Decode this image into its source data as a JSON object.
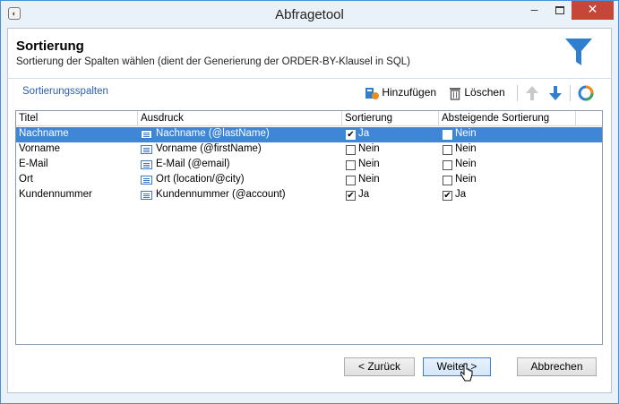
{
  "window": {
    "title": "Abfragetool"
  },
  "header": {
    "title": "Sortierung",
    "subtitle": "Sortierung der Spalten wählen (dient der Generierung der ORDER-BY-Klausel in SQL)"
  },
  "section": {
    "label": "Sortierungsspalten"
  },
  "toolbar": {
    "add_label": "Hinzufügen",
    "delete_label": "Löschen"
  },
  "table": {
    "headers": [
      "Titel",
      "Ausdruck",
      "Sortierung",
      "Absteigende Sortierung"
    ],
    "rows": [
      {
        "title": "Nachname",
        "expression": "Nachname (@lastName)",
        "sort_checked": true,
        "sort_label": "Ja",
        "desc_checked": false,
        "desc_label": "Nein",
        "selected": true
      },
      {
        "title": "Vorname",
        "expression": "Vorname (@firstName)",
        "sort_checked": false,
        "sort_label": "Nein",
        "desc_checked": false,
        "desc_label": "Nein",
        "selected": false
      },
      {
        "title": "E-Mail",
        "expression": "E-Mail (@email)",
        "sort_checked": false,
        "sort_label": "Nein",
        "desc_checked": false,
        "desc_label": "Nein",
        "selected": false
      },
      {
        "title": "Ort",
        "expression": "Ort (location/@city)",
        "sort_checked": false,
        "sort_label": "Nein",
        "desc_checked": false,
        "desc_label": "Nein",
        "selected": false
      },
      {
        "title": "Kundennummer",
        "expression": "Kundennummer (@account)",
        "sort_checked": true,
        "sort_label": "Ja",
        "desc_checked": true,
        "desc_label": "Ja",
        "selected": false
      }
    ]
  },
  "buttons": {
    "back": "< Zurück",
    "next": "Weiter >",
    "cancel": "Abbrechen"
  },
  "colors": {
    "accent": "#3f86d9",
    "funnel": "#2f7fd0",
    "close": "#c7463a"
  }
}
